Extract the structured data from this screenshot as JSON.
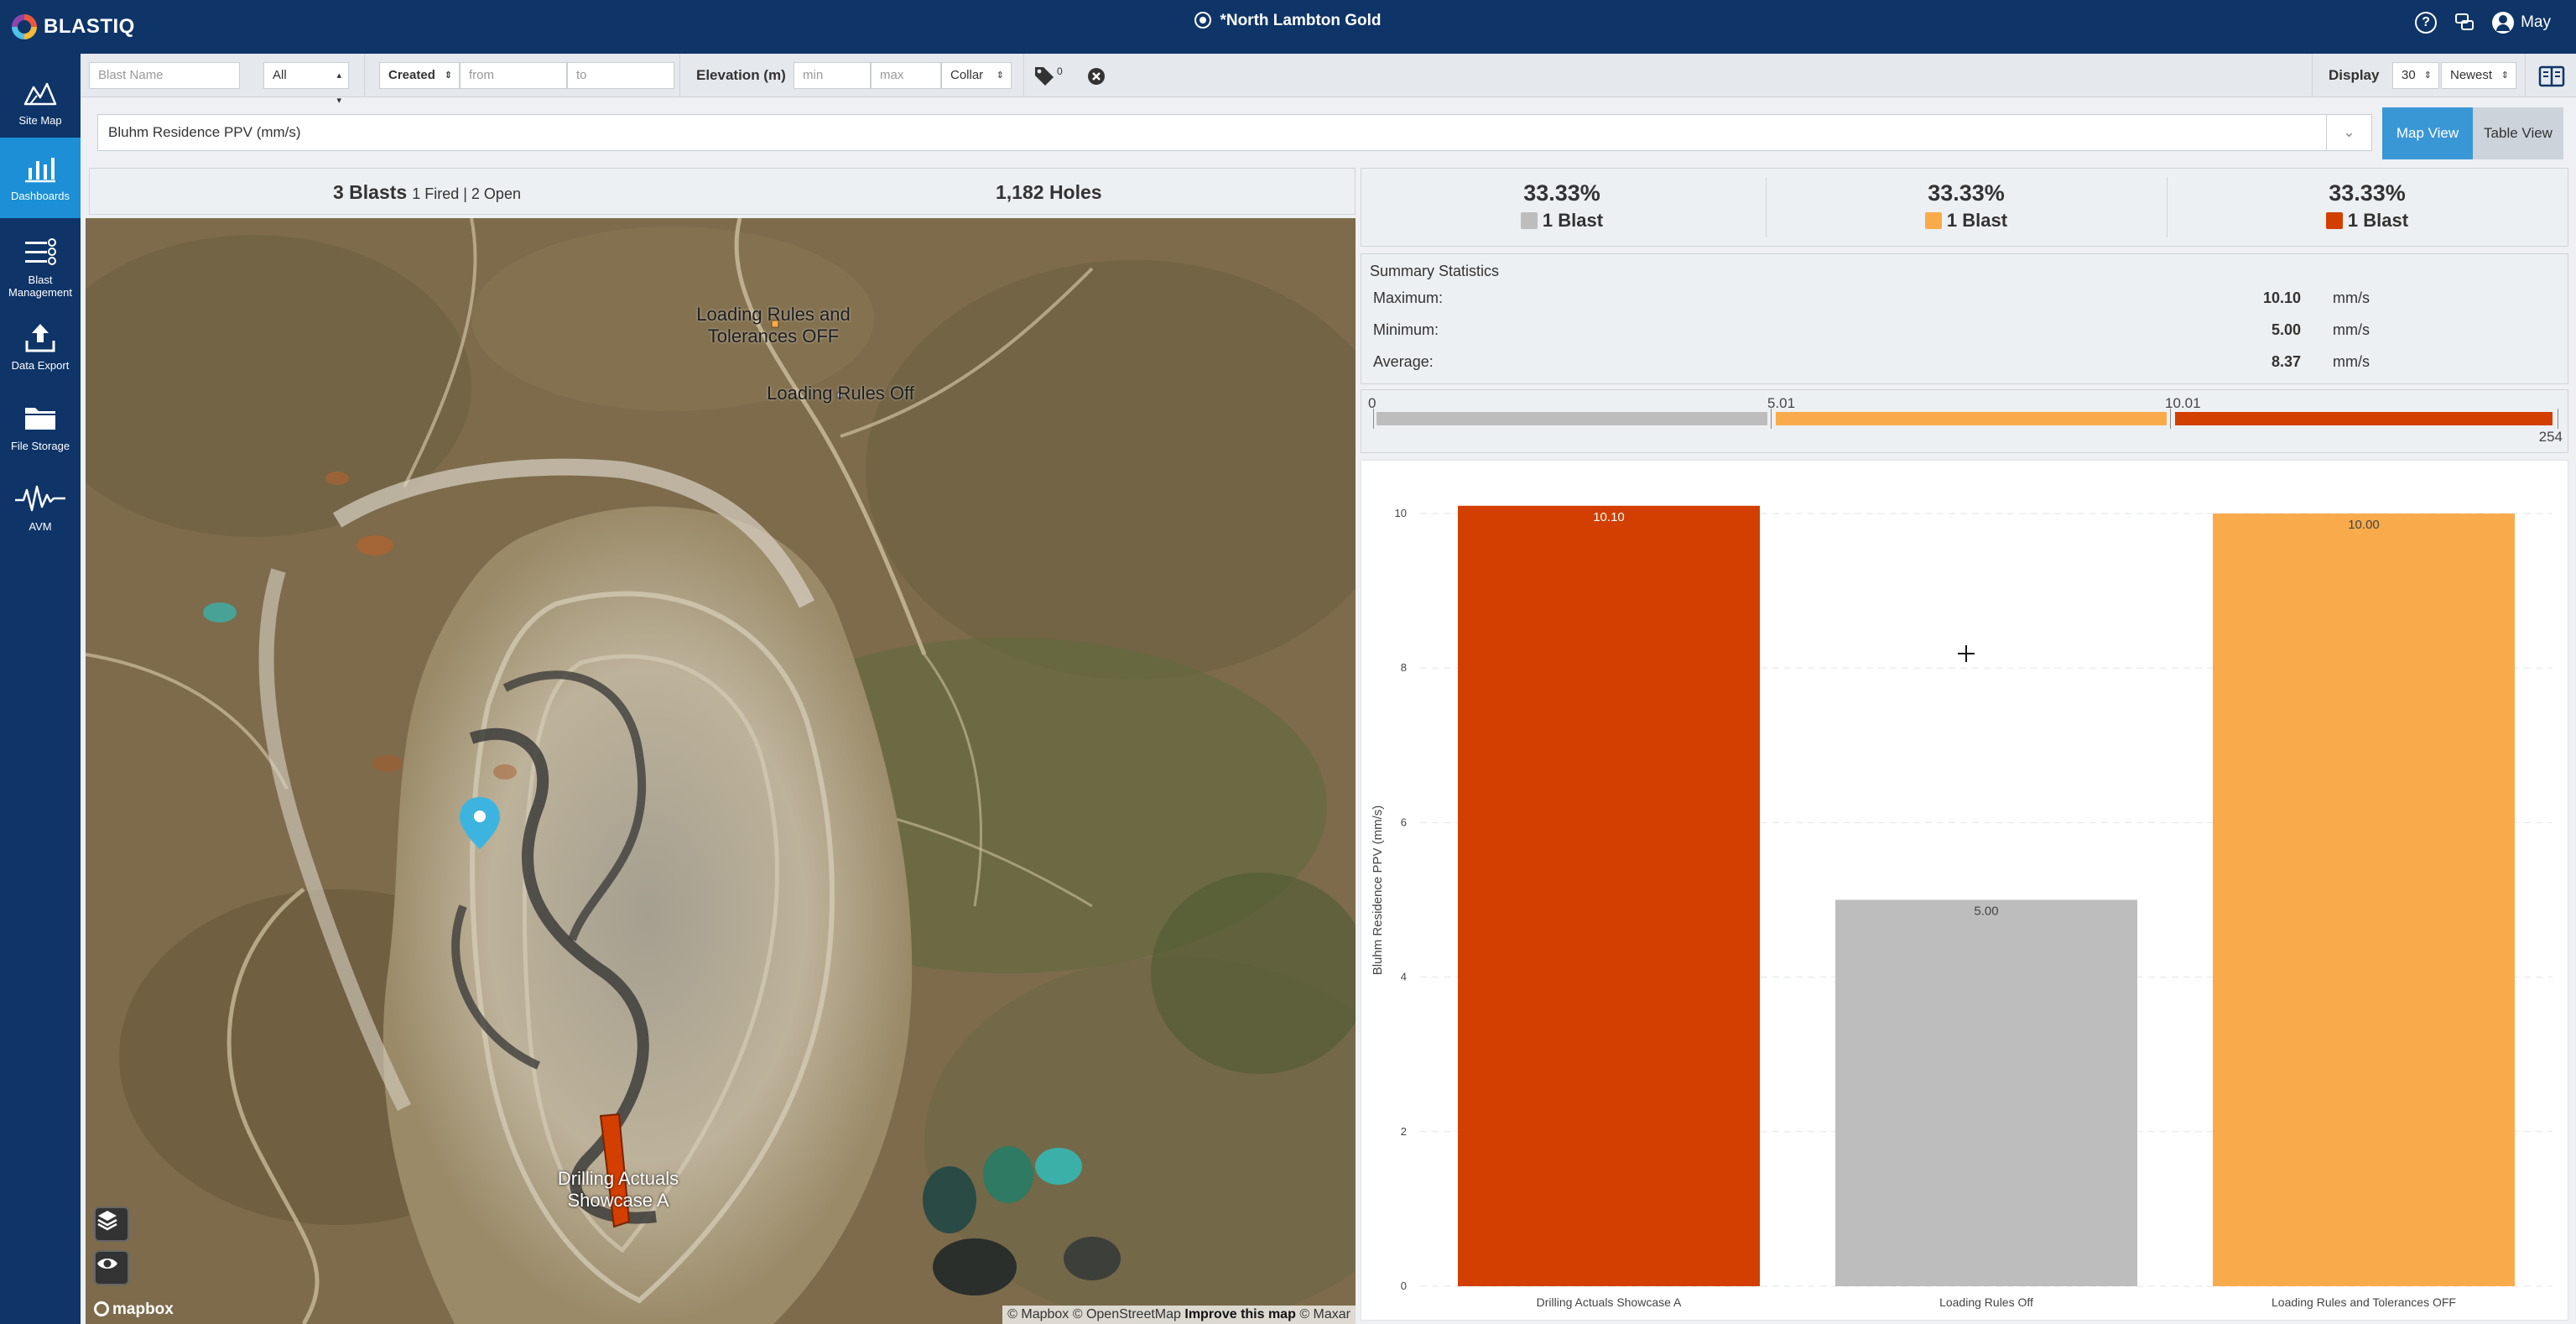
{
  "app": {
    "logo_text": "BLASTIQ",
    "site_title": "*North Lambton Gold",
    "user": "May"
  },
  "sidebar": {
    "items": [
      {
        "label_1": "Site Map",
        "label_2": ""
      },
      {
        "label_1": "Dashboards",
        "label_2": ""
      },
      {
        "label_1": "Blast",
        "label_2": "Management"
      },
      {
        "label_1": "Data Export",
        "label_2": ""
      },
      {
        "label_1": "File Storage",
        "label_2": ""
      },
      {
        "label_1": "AVM",
        "label_2": ""
      }
    ]
  },
  "filters": {
    "blast_name_placeholder": "Blast Name",
    "status_value": "All",
    "date_type": "Created",
    "from_placeholder": "from",
    "to_placeholder": "to",
    "elevation_label": "Elevation (m)",
    "min_placeholder": "min",
    "max_placeholder": "max",
    "elevation_ref": "Collar",
    "tag_count": "0",
    "display_label": "Display",
    "page_size": "30",
    "sort": "Newest"
  },
  "metric_select": {
    "value": "Bluhm Residence PPV (mm/s)"
  },
  "view_toggle": {
    "map": "Map View",
    "table": "Table View"
  },
  "map_summary": {
    "blasts": "3 Blasts",
    "fired_open": "1 Fired | 2 Open",
    "holes": "1,182 Holes"
  },
  "map": {
    "labels": {
      "loading_tol_1": "Loading Rules and",
      "loading_tol_2": "Tolerances OFF",
      "loading_off": "Loading Rules Off",
      "drilling_1": "Drilling Actuals",
      "drilling_2": "Showcase A"
    },
    "logo": "mapbox",
    "attribution_1": "© Mapbox © OpenStreetMap",
    "attribution_2": "Improve this map",
    "attribution_3": "© Maxar"
  },
  "percentages": [
    {
      "value": "33.33%",
      "label": "1 Blast",
      "color": "#bdbdbd"
    },
    {
      "value": "33.33%",
      "label": "1 Blast",
      "color": "#f9ab4b"
    },
    {
      "value": "33.33%",
      "label": "1 Blast",
      "color": "#d23f00"
    }
  ],
  "summary_stats": {
    "title": "Summary Statistics",
    "rows": [
      {
        "label": "Maximum:",
        "value": "10.10",
        "unit": "mm/s"
      },
      {
        "label": "Minimum:",
        "value": "5.00",
        "unit": "mm/s"
      },
      {
        "label": "Average:",
        "value": "8.37",
        "unit": "mm/s"
      }
    ]
  },
  "range_bar": {
    "breaks": [
      "0",
      "5.01",
      "10.01"
    ],
    "end": "254",
    "colors": [
      "#bdbdbd",
      "#f9ab4b",
      "#d23f00"
    ]
  },
  "chart_data": {
    "type": "bar",
    "categories": [
      "Drilling Actuals Showcase A",
      "Loading Rules Off",
      "Loading Rules and Tolerances OFF"
    ],
    "values": [
      10.1,
      5.0,
      10.0
    ],
    "value_labels": [
      "10.10",
      "5.00",
      "10.00"
    ],
    "colors": [
      "#d23f00",
      "#bdbdbd",
      "#f9ab4b"
    ],
    "ylabel": "Bluhm Residence PPV (mm/s)",
    "ylim": [
      0,
      10.25
    ],
    "yticks": [
      0,
      2,
      4,
      6,
      8,
      10
    ],
    "grid": true
  }
}
